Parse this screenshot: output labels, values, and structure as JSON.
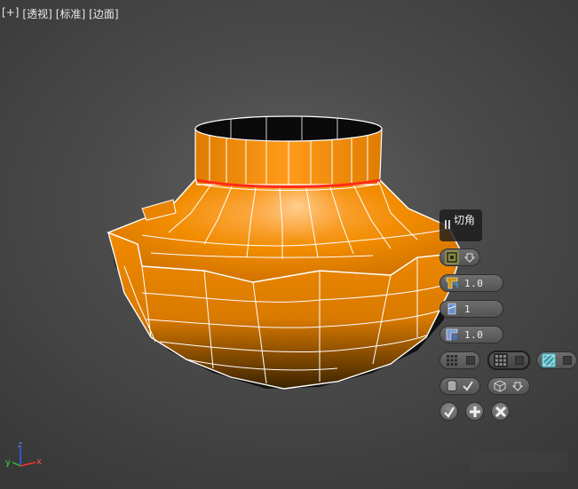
{
  "viewport": {
    "labels": [
      "[+]",
      "[透视]",
      "[标准]",
      "[边面]"
    ]
  },
  "caddy": {
    "title": "切角",
    "amount": "1.0",
    "segments": "1",
    "tension": "1.0"
  },
  "axis": {
    "x": "x",
    "y": "y",
    "z": "z"
  },
  "colors": {
    "accent_orange": "#f28c00",
    "selected_edge": "#ff2a1a",
    "viewport_bg": "#4a4a4a"
  },
  "icons": [
    "pause-icon",
    "ring-select-icon",
    "dropdown-arrow-icon",
    "amount-icon",
    "segments-icon",
    "tension-icon",
    "grid-quad-icon",
    "grid-dark-icon",
    "grid-tri-icon",
    "cylinder-icon",
    "check-icon",
    "cube-icon",
    "ok-icon",
    "apply-icon",
    "cancel-icon"
  ]
}
